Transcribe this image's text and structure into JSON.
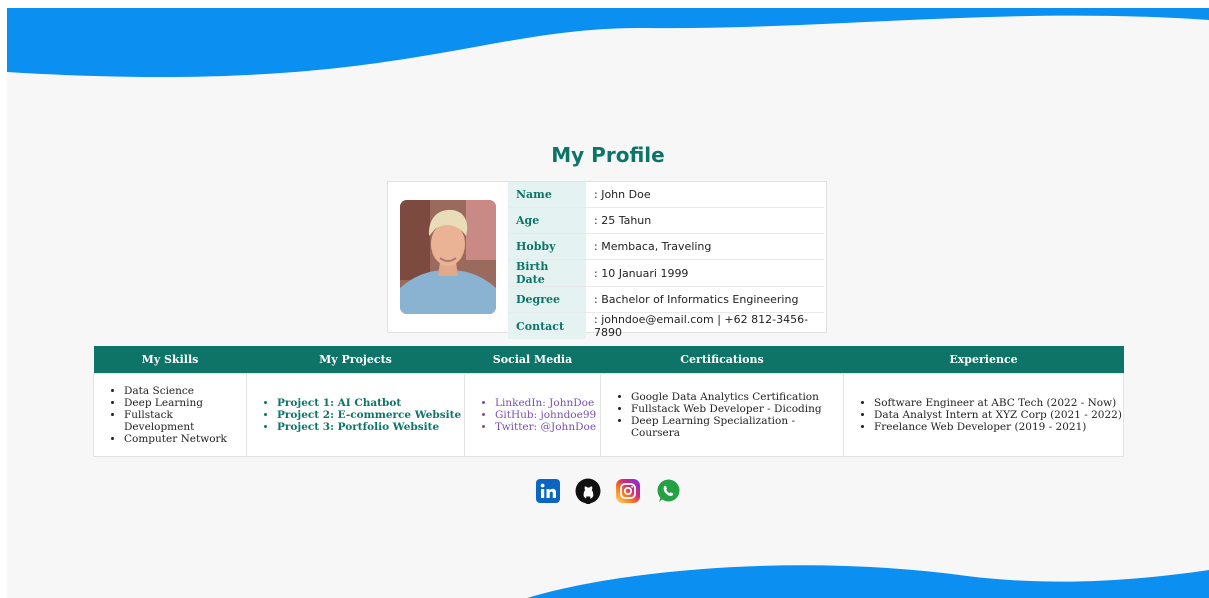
{
  "page_title": "My Profile",
  "profile": [
    {
      "label": "Name",
      "value": ": John Doe"
    },
    {
      "label": "Age",
      "value": ": 25 Tahun"
    },
    {
      "label": "Hobby",
      "value": ": Membaca, Traveling"
    },
    {
      "label": "Birth Date",
      "value": ": 10 Januari 1999"
    },
    {
      "label": "Degree",
      "value": ": Bachelor of Informatics Engineering"
    },
    {
      "label": "Contact",
      "value": ": johndoe@email.com | +62 812-3456-7890"
    }
  ],
  "sections": [
    {
      "title": "My Skills",
      "items": [
        "Data Science",
        "Deep Learning",
        "Fullstack Development",
        "Computer Network"
      ]
    },
    {
      "title": "My Projects",
      "items": [
        "Project 1: AI Chatbot",
        "Project 2: E-commerce Website",
        "Project 3: Portfolio Website"
      ]
    },
    {
      "title": "Social Media",
      "items": [
        "LinkedIn: JohnDoe",
        "GitHub: johndoe99",
        "Twitter: @JohnDoe"
      ]
    },
    {
      "title": "Certifications",
      "items": [
        "Google Data Analytics Certification",
        "Fullstack Web Developer - Dicoding",
        "Deep Learning Specialization - Coursera"
      ]
    },
    {
      "title": "Experience",
      "items": [
        "Software Engineer at ABC Tech (2022 - Now)",
        "Data Analyst Intern at XYZ Corp (2021 - 2022)",
        "Freelance Web Developer (2019 - 2021)"
      ]
    }
  ],
  "social_icons": [
    "linkedin-icon",
    "github-icon",
    "instagram-icon",
    "whatsapp-icon"
  ],
  "colors": {
    "accent": "#0d7467",
    "wave": "#0b8ff0",
    "link": "#7a4fb1"
  }
}
